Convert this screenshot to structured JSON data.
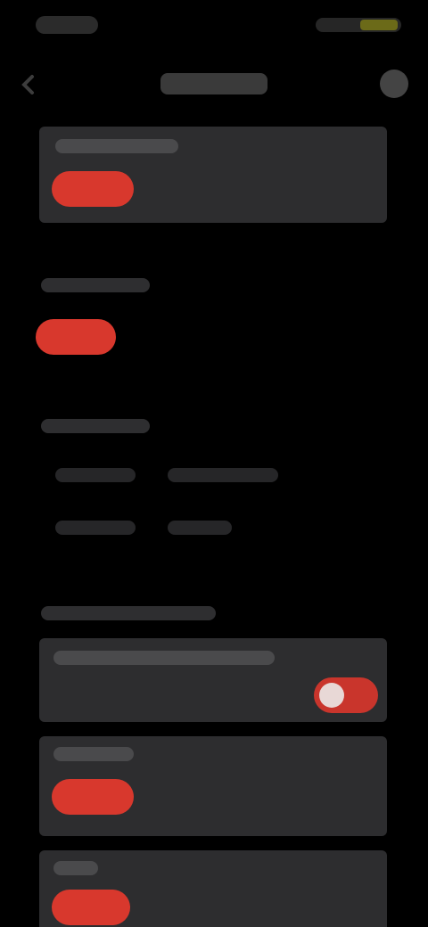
{
  "status_bar": {
    "time": "",
    "indicators": ""
  },
  "header": {
    "title": "",
    "back_icon": "chevron-left-icon",
    "menu_icon": "more-icon"
  },
  "section_1": {
    "label": "",
    "button_label": ""
  },
  "section_2": {
    "label": "",
    "button_label": ""
  },
  "section_3": {
    "label": "",
    "rows": [
      {
        "key": "",
        "value": ""
      },
      {
        "key": "",
        "value": ""
      }
    ]
  },
  "section_4": {
    "label": "",
    "toggle_card": {
      "label": "",
      "toggle_on": true
    },
    "card_2": {
      "label": "",
      "button_label": ""
    },
    "card_3": {
      "label": "",
      "button_label": ""
    }
  },
  "colors": {
    "background": "#000000",
    "card": "#2d2d2f",
    "accent": "#d8382d",
    "battery": "#6b6a18"
  }
}
